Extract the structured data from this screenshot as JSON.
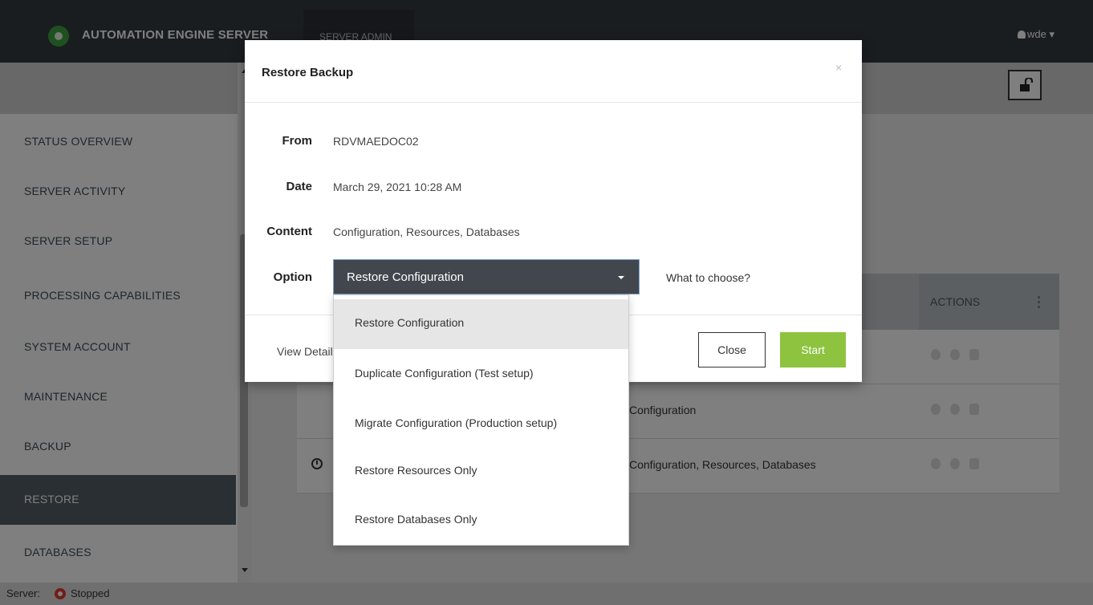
{
  "topbar": {
    "brand": "AUTOMATION ENGINE SERVER",
    "tab": "SERVER ADMIN",
    "user": "wde"
  },
  "sidebar": {
    "items": [
      {
        "label": "STATUS OVERVIEW"
      },
      {
        "label": "SERVER ACTIVITY"
      },
      {
        "label": "SERVER SETUP"
      },
      {
        "label": "PROCESSING CAPABILITIES"
      },
      {
        "label": "SYSTEM ACCOUNT"
      },
      {
        "label": "MAINTENANCE"
      },
      {
        "label": "BACKUP"
      },
      {
        "label": "RESTORE",
        "active": true
      },
      {
        "label": "DATABASES"
      }
    ]
  },
  "table": {
    "actions_header": "ACTIONS",
    "rows": [
      {
        "content": ""
      },
      {
        "content": "Configuration"
      },
      {
        "content": "Configuration, Resources, Databases"
      }
    ]
  },
  "status": {
    "label": "Server:",
    "state": "Stopped"
  },
  "modal": {
    "title": "Restore Backup",
    "close_symbol": "×",
    "from_label": "From",
    "from_value": "RDVMAEDOC02",
    "date_label": "Date",
    "date_value": "March 29, 2021 10:28 AM",
    "content_label": "Content",
    "content_value": "Configuration, Resources, Databases",
    "option_label": "Option",
    "option_selected": "Restore Configuration",
    "help_link": "What to choose?",
    "view_details": "View Details",
    "close_button": "Close",
    "start_button": "Start"
  },
  "dropdown": {
    "options": [
      "Restore Configuration",
      "Duplicate Configuration (Test setup)",
      "Migrate Configuration (Production setup)",
      "Restore Resources Only",
      "Restore Databases Only"
    ]
  },
  "colors": {
    "accent_green": "#8dc33f",
    "brand_green": "#3da33f",
    "topbar": "#343a40",
    "stopped_red": "#e23b2e"
  }
}
